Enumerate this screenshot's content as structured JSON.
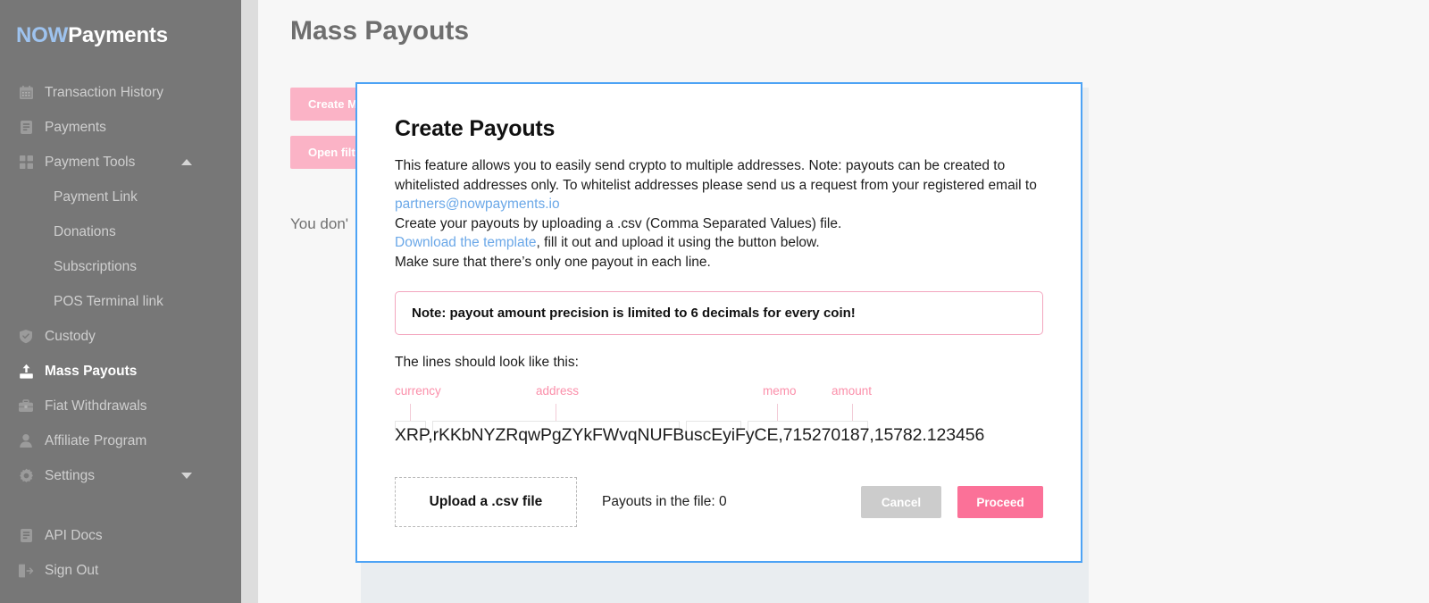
{
  "brand": {
    "prefix": "NOW",
    "suffix": "Payments"
  },
  "sidebar": {
    "items": [
      {
        "label": "Transaction History",
        "icon": "calendar-icon"
      },
      {
        "label": "Payments",
        "icon": "document-icon"
      },
      {
        "label": "Payment Tools",
        "icon": "grid-icon",
        "caret": "chevron-up-icon"
      },
      {
        "label": "Payment Link",
        "icon": ""
      },
      {
        "label": "Donations",
        "icon": ""
      },
      {
        "label": "Subscriptions",
        "icon": ""
      },
      {
        "label": "POS Terminal link",
        "icon": ""
      },
      {
        "label": "Custody",
        "icon": "shield-check-icon"
      },
      {
        "label": "Mass Payouts",
        "icon": "upload-icon"
      },
      {
        "label": "Fiat Withdrawals",
        "icon": "briefcase-icon"
      },
      {
        "label": "Affiliate Program",
        "icon": "person-icon"
      },
      {
        "label": "Settings",
        "icon": "gear-icon",
        "caret": "chevron-down-icon"
      },
      {
        "label": "API Docs",
        "icon": "document-icon"
      },
      {
        "label": "Sign Out",
        "icon": "sign-out-icon"
      }
    ]
  },
  "page": {
    "title": "Mass Payouts",
    "button_create": "Create M",
    "button_filter": "Open filt",
    "empty_text": "You don'"
  },
  "modal": {
    "title": "Create Payouts",
    "desc_line1": "This feature allows you to easily send crypto to multiple addresses. Note: payouts can be created to whitelisted addresses only. To whitelist addresses please send us a request from your registered email to ",
    "desc_email": "partners@nowpayments.io",
    "desc_line2": "Create your payouts by uploading a .csv (Comma Separated Values) file.",
    "desc_link": "Download the template",
    "desc_line3": ", fill it out and upload it using the button below.",
    "desc_line4": "Make sure that there’s only one payout in each line.",
    "note": "Note: payout amount precision is limited to 6 decimals for every coin!",
    "lines_label": "The lines should look like this:",
    "csv_labels": [
      "currency",
      "address",
      "memo",
      "amount"
    ],
    "csv_example": "XRP,rKKbNYZRqwPgZYkFWvqNUFBuscEyiFyCE,715270187,15782.123456",
    "upload_label": "Upload a .csv file",
    "payouts_in_file": "Payouts in the file: 0",
    "cancel_label": "Cancel",
    "proceed_label": "Proceed"
  },
  "colors": {
    "brand_blue": "#9ec3ef",
    "accent_pink": "#fb7198",
    "modal_border_blue": "#4da3f5",
    "sidebar_bg": "#777777",
    "link_blue": "#6ba8e8"
  }
}
